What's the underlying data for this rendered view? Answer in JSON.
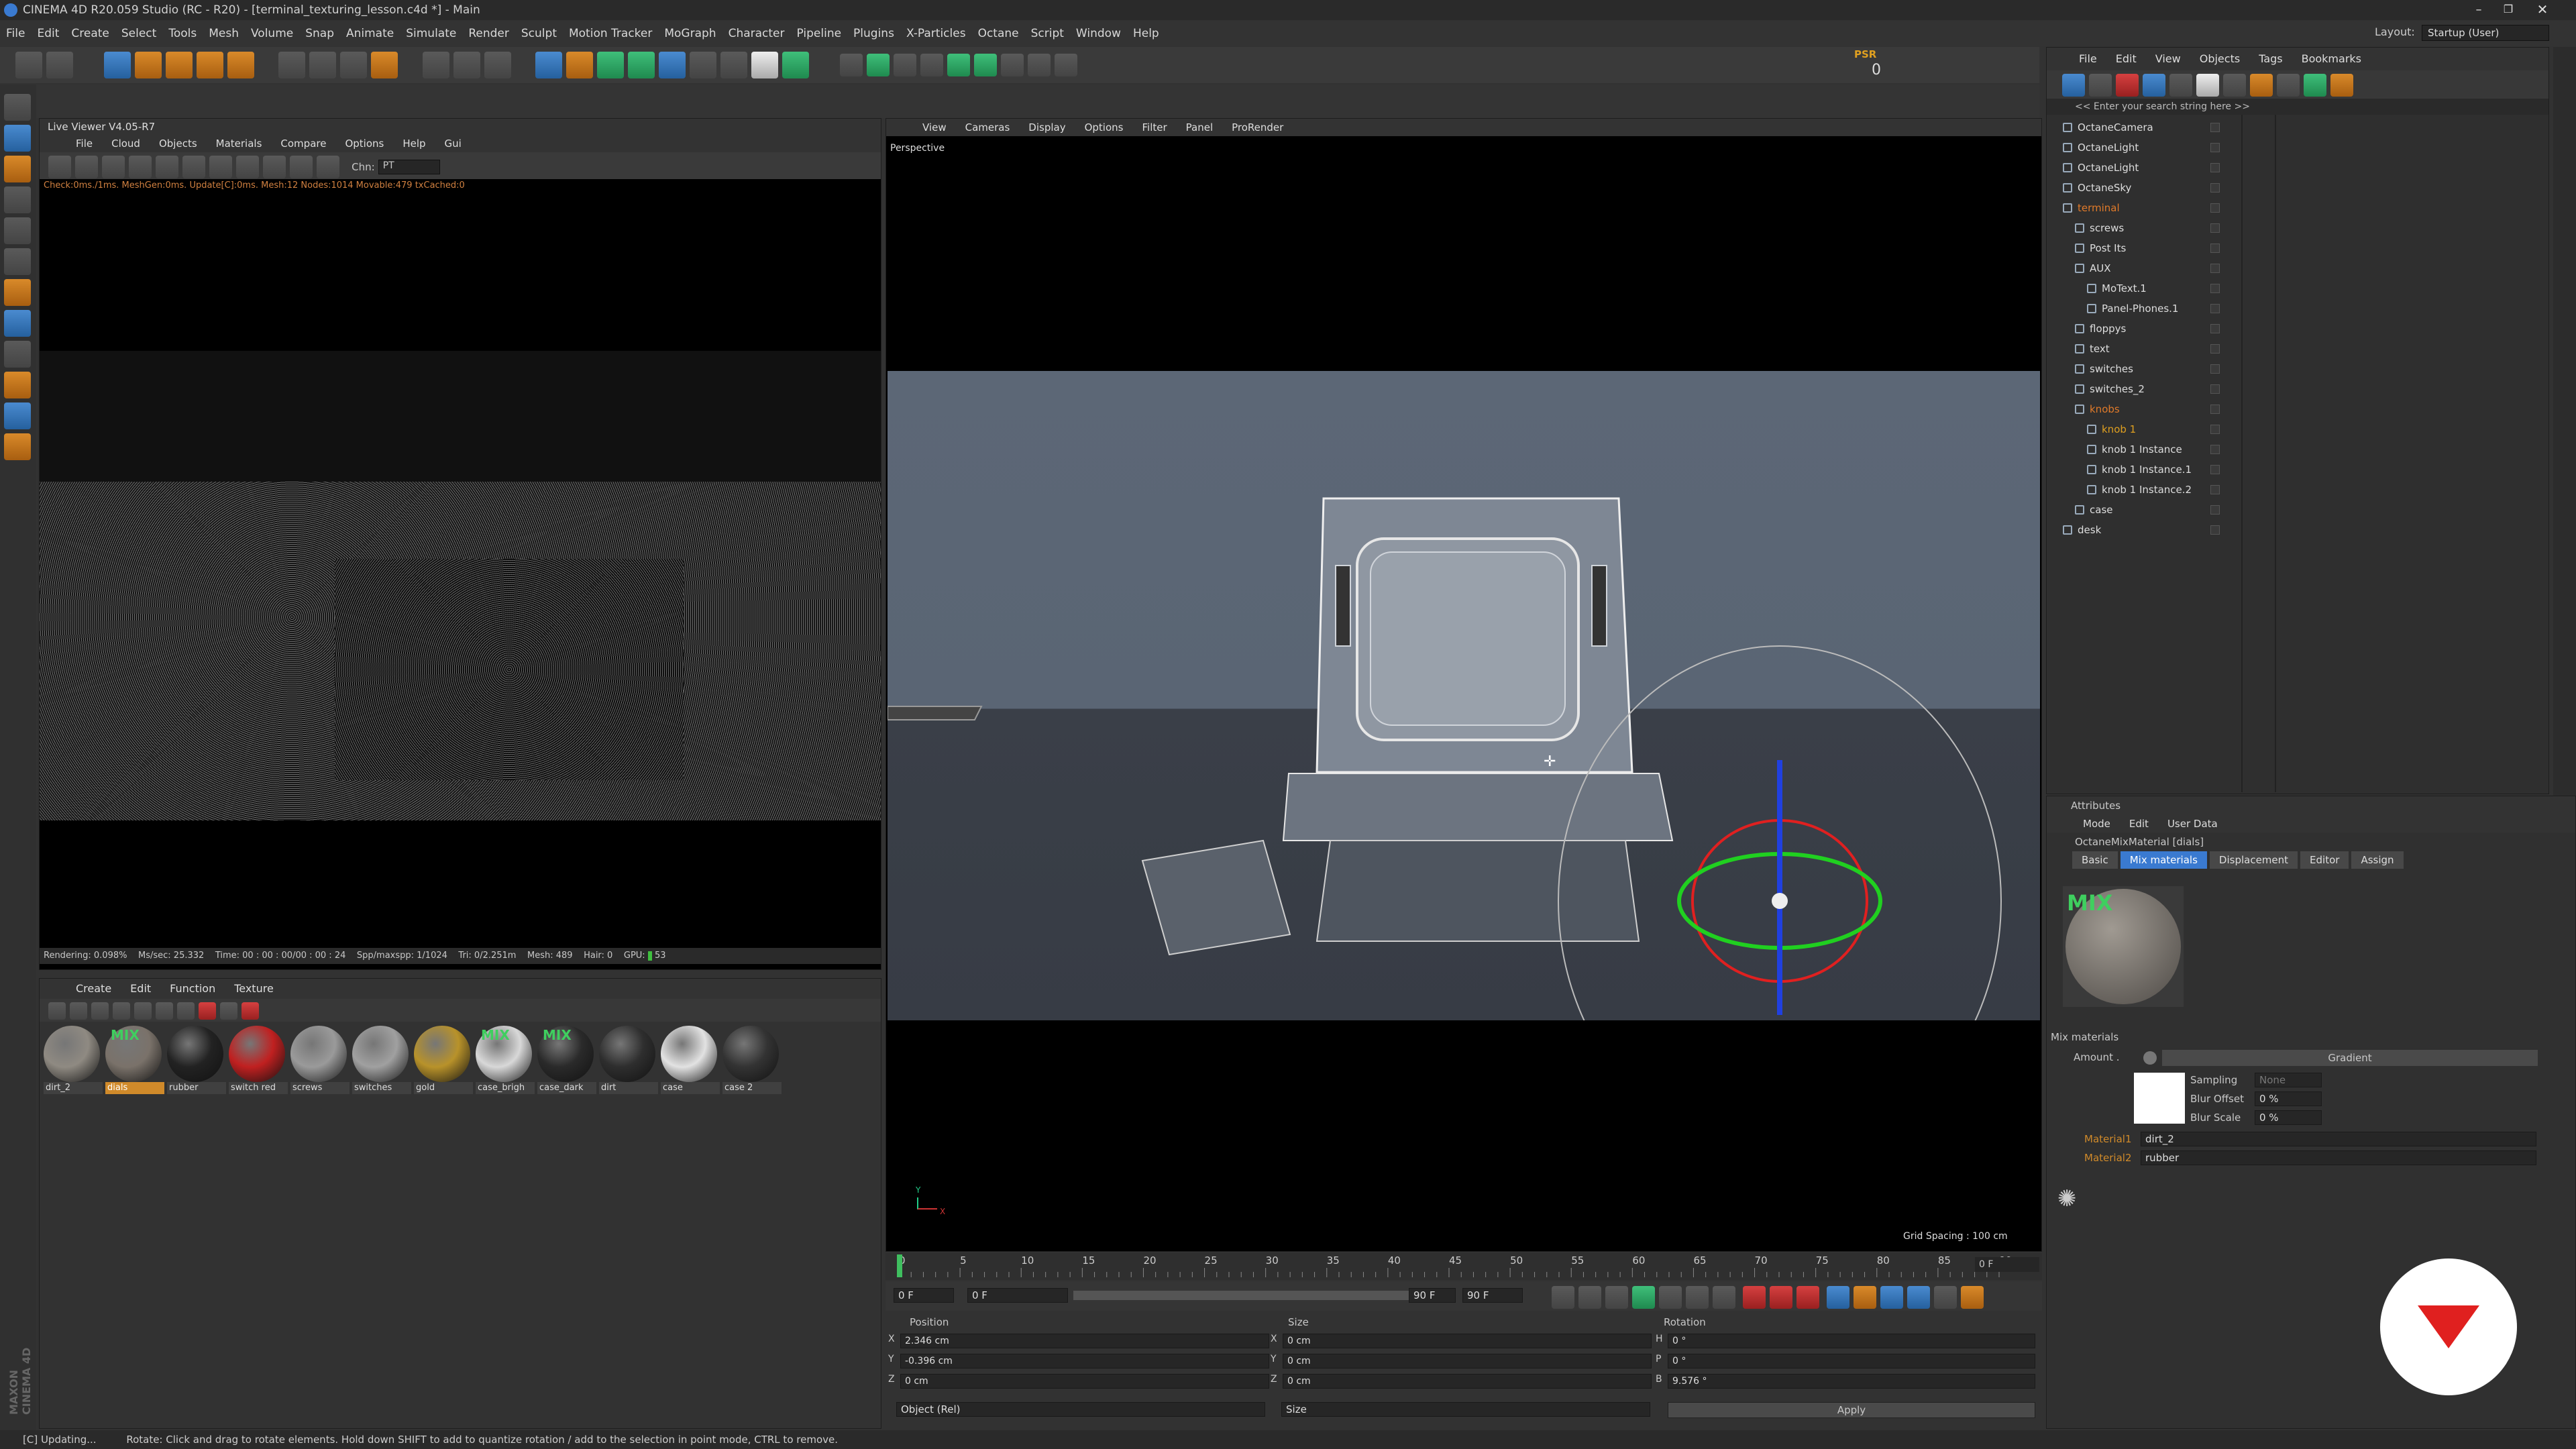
{
  "window": {
    "title": "CINEMA 4D R20.059 Studio (RC - R20) - [terminal_texturing_lesson.c4d *] - Main"
  },
  "menu": [
    "File",
    "Edit",
    "Create",
    "Select",
    "Tools",
    "Mesh",
    "Volume",
    "Snap",
    "Animate",
    "Simulate",
    "Render",
    "Sculpt",
    "Motion Tracker",
    "MoGraph",
    "Character",
    "Pipeline",
    "Plugins",
    "X-Particles",
    "Octane",
    "Script",
    "Window",
    "Help"
  ],
  "layout": {
    "label": "Layout:",
    "value": "Startup (User)"
  },
  "psr": {
    "label": "PSR",
    "value": "0"
  },
  "live_viewer": {
    "title": "Live Viewer V4.05-R7",
    "menu": [
      "File",
      "Cloud",
      "Objects",
      "Materials",
      "Compare",
      "Options",
      "Help",
      "Gui"
    ],
    "chn_label": "Chn:",
    "chn_value": "PT",
    "check_text": "Check:0ms./1ms. MeshGen:0ms. Update[C]:0ms. Mesh:12 Nodes:1014 Movable:479 txCached:0",
    "stats": {
      "rendering": "Rendering: 0.098%",
      "mssec": "Ms/sec: 25.332",
      "time": "Time: 00 : 00 : 00/00 : 00 : 24",
      "spp": "Spp/maxspp: 1/1024",
      "tri": "Tri: 0/2.251m",
      "mesh": "Mesh: 489",
      "hair": "Hair: 0",
      "gpu": "GPU:",
      "gpu_val": "53"
    }
  },
  "material_manager": {
    "menu": [
      "Create",
      "Edit",
      "Function",
      "Texture"
    ],
    "materials": [
      {
        "name": "dirt_2",
        "color": "#8f8a82",
        "mix": false,
        "selected": false
      },
      {
        "name": "dials",
        "color": "#7a726a",
        "mix": true,
        "selected": true
      },
      {
        "name": "rubber",
        "color": "#222222",
        "mix": false,
        "selected": false
      },
      {
        "name": "switch red",
        "color": "#c02020",
        "mix": false,
        "selected": false
      },
      {
        "name": "screws",
        "color": "#9a9a9a",
        "mix": false,
        "selected": false
      },
      {
        "name": "switches",
        "color": "#a0a0a0",
        "mix": false,
        "selected": false
      },
      {
        "name": "gold",
        "color": "#b8922a",
        "mix": false,
        "selected": false
      },
      {
        "name": "case_brigh",
        "color": "#d8d8d8",
        "mix": true,
        "selected": false
      },
      {
        "name": "case_dark",
        "color": "#2a2a2a",
        "mix": true,
        "selected": false
      },
      {
        "name": "dirt",
        "color": "#2e2e2e",
        "mix": false,
        "selected": false
      },
      {
        "name": "case",
        "color": "#e2e2e2",
        "mix": false,
        "selected": false
      },
      {
        "name": "case 2",
        "color": "#333333",
        "mix": false,
        "selected": false
      }
    ],
    "mix_label": "MIX"
  },
  "viewport": {
    "menu": [
      "View",
      "Cameras",
      "Display",
      "Options",
      "Filter",
      "Panel",
      "ProRender"
    ],
    "camera_label": "Perspective",
    "grid_spacing": "Grid Spacing : 100 cm",
    "axis_y": "Y",
    "axis_x": "X"
  },
  "timeline": {
    "ticks": [
      "0",
      "5",
      "10",
      "15",
      "20",
      "25",
      "30",
      "35",
      "40",
      "45",
      "50",
      "55",
      "60",
      "65",
      "70",
      "75",
      "80",
      "85",
      "90"
    ],
    "current_frame": "0 F",
    "start": "0 F",
    "start2": "0 F",
    "end": "90 F",
    "end2": "90 F",
    "frame_end_box": "90 F"
  },
  "coordinates": {
    "headers": {
      "position": "Position",
      "size": "Size",
      "rotation": "Rotation"
    },
    "rows": [
      {
        "axis": "X",
        "pos": "2.346 cm",
        "size_axis": "X",
        "size": "0 cm",
        "rot_axis": "H",
        "rot": "0 °"
      },
      {
        "axis": "Y",
        "pos": "-0.396 cm",
        "size_axis": "Y",
        "size": "0 cm",
        "rot_axis": "P",
        "rot": "0 °"
      },
      {
        "axis": "Z",
        "pos": "0 cm",
        "size_axis": "Z",
        "size": "0 cm",
        "rot_axis": "B",
        "rot": "9.576 °"
      }
    ],
    "mode_select": "Object (Rel)",
    "size_select": "Size",
    "apply_label": "Apply"
  },
  "object_manager": {
    "menu": [
      "File",
      "Edit",
      "View",
      "Objects",
      "Tags",
      "Bookmarks"
    ],
    "search_placeholder": "<< Enter your search string here >>",
    "objects": [
      {
        "name": "OctaneCamera",
        "indent": 0,
        "color": "#ddd"
      },
      {
        "name": "OctaneLight",
        "indent": 0,
        "color": "#ddd"
      },
      {
        "name": "OctaneLight",
        "indent": 0,
        "color": "#ddd"
      },
      {
        "name": "OctaneSky",
        "indent": 0,
        "color": "#ddd"
      },
      {
        "name": "terminal",
        "indent": 0,
        "color": "#e07a2a"
      },
      {
        "name": "screws",
        "indent": 1,
        "color": "#ddd"
      },
      {
        "name": "Post Its",
        "indent": 1,
        "color": "#ddd"
      },
      {
        "name": "AUX",
        "indent": 1,
        "color": "#ddd"
      },
      {
        "name": "MoText.1",
        "indent": 2,
        "color": "#ddd"
      },
      {
        "name": "Panel-Phones.1",
        "indent": 2,
        "color": "#ddd"
      },
      {
        "name": "floppys",
        "indent": 1,
        "color": "#ddd"
      },
      {
        "name": "text",
        "indent": 1,
        "color": "#ddd"
      },
      {
        "name": "switches",
        "indent": 1,
        "color": "#ddd"
      },
      {
        "name": "switches_2",
        "indent": 1,
        "color": "#ddd"
      },
      {
        "name": "knobs",
        "indent": 1,
        "color": "#e07a2a"
      },
      {
        "name": "knob 1",
        "indent": 2,
        "color": "#e0a020"
      },
      {
        "name": "knob 1 Instance",
        "indent": 2,
        "color": "#ddd"
      },
      {
        "name": "knob 1 Instance.1",
        "indent": 2,
        "color": "#ddd"
      },
      {
        "name": "knob 1 Instance.2",
        "indent": 2,
        "color": "#ddd"
      },
      {
        "name": "case",
        "indent": 1,
        "color": "#ddd"
      },
      {
        "name": "desk",
        "indent": 0,
        "color": "#ddd"
      }
    ]
  },
  "attributes": {
    "title": "Attributes",
    "menu": [
      "Mode",
      "Edit",
      "User Data"
    ],
    "object_name": "OctaneMixMaterial [dials]",
    "tabs": [
      "Basic",
      "Mix materials",
      "Displacement",
      "Editor",
      "Assign"
    ],
    "active_tab": "Mix materials",
    "section": "Mix materials",
    "amount_label": "Amount .",
    "gradient_label": "Gradient",
    "sampling_label": "Sampling",
    "sampling_value": "None",
    "blur_offset_label": "Blur Offset",
    "blur_offset_value": "0 %",
    "blur_scale_label": "Blur Scale",
    "blur_scale_value": "0 %",
    "material1_label": "Material1",
    "material1_value": "dirt_2",
    "material2_label": "Material2",
    "material2_value": "rubber"
  },
  "status_bar": {
    "updating": "[C] Updating...",
    "hint": "Rotate: Click and drag to rotate elements. Hold down SHIFT to add to quantize rotation / add to the selection in point mode, CTRL to remove."
  },
  "branding": {
    "maxon_logo": "MAXON CINEMA 4D"
  },
  "colors": {
    "accent_blue": "#3a7ad0",
    "selected_orange": "#d08a2a",
    "terminal_orange": "#e07a2a",
    "brand_red": "#e0201f"
  }
}
